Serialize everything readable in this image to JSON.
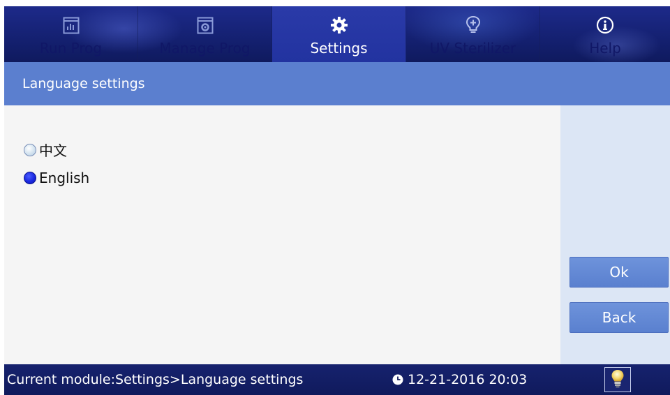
{
  "tabs": [
    {
      "label": "Run Prog",
      "icon": "chart-icon",
      "active": false
    },
    {
      "label": "Manage Prog",
      "icon": "gear-doc-icon",
      "active": false
    },
    {
      "label": "Settings",
      "icon": "gear-icon",
      "active": true
    },
    {
      "label": "UV Sterilizer",
      "icon": "bulb-plus-icon",
      "active": false
    },
    {
      "label": "Help",
      "icon": "info-icon",
      "active": false
    }
  ],
  "title": "Language settings",
  "options": [
    {
      "label": "中文",
      "selected": false
    },
    {
      "label": "English",
      "selected": true
    }
  ],
  "buttons": {
    "ok": "Ok",
    "back": "Back"
  },
  "status": {
    "module_text": "Current module:Settings>Language settings",
    "datetime": "12-21-2016 20:03"
  },
  "colors": {
    "header_bg": "#142070",
    "title_bar": "#5b7fcf",
    "button": "#5a80cf",
    "right_panel": "#dce6f5",
    "status_bar": "#101a5c",
    "radio_selected": "#1a28e0"
  }
}
